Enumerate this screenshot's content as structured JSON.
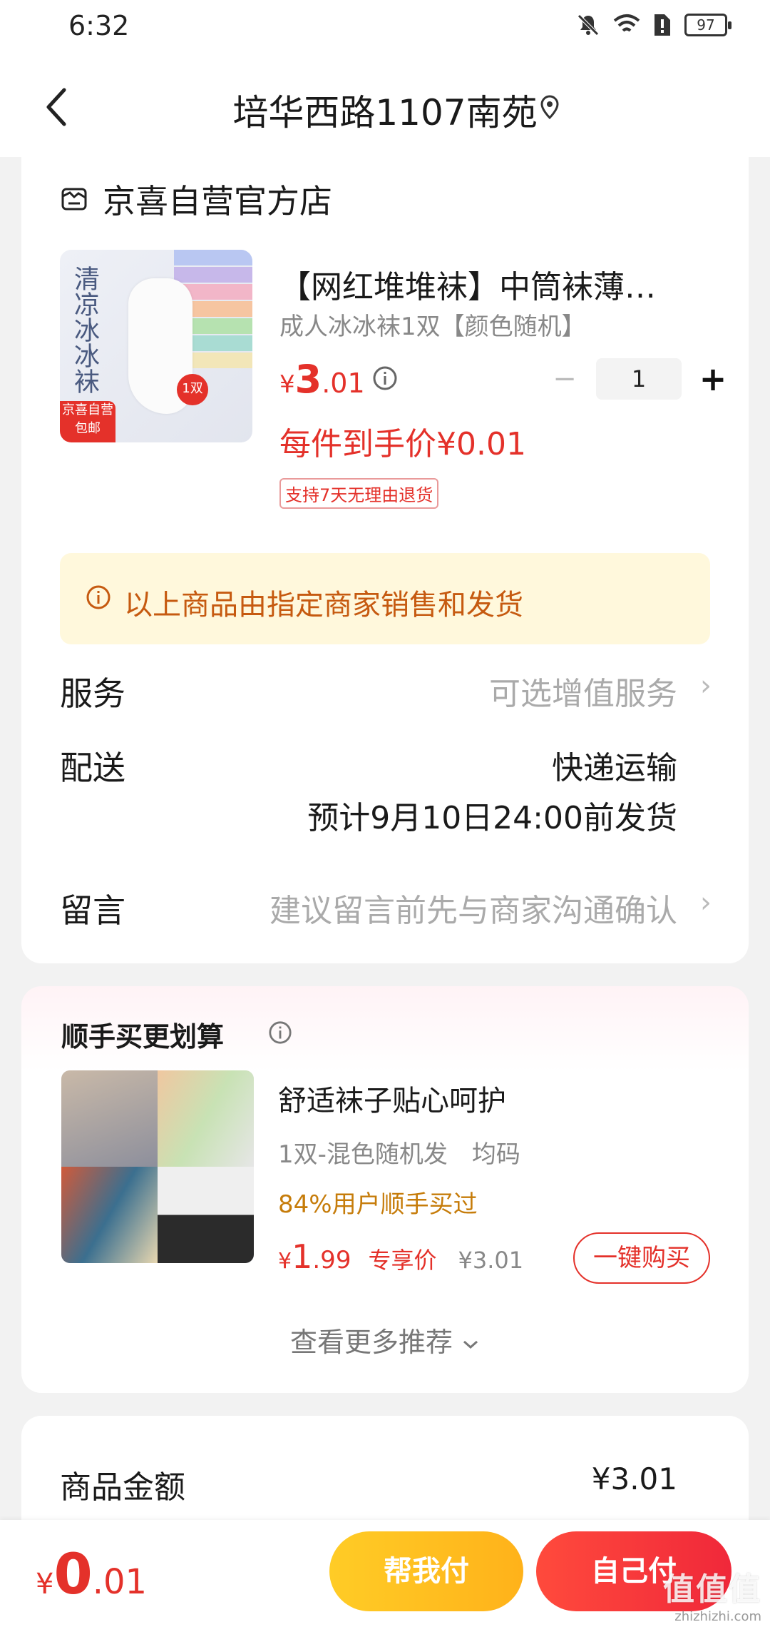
{
  "status_bar": {
    "time": "6:32",
    "battery": "97"
  },
  "header": {
    "title": "培华西路1107南苑"
  },
  "store": {
    "name": "京喜自营官方店"
  },
  "product": {
    "image_text": "清凉冰冰袜",
    "image_badge": "京喜自营 包邮",
    "image_count": "1双",
    "title": "【网红堆堆袜】中筒袜薄…",
    "spec": "成人冰冰袜1双【颜色随机】",
    "price_symbol": "¥",
    "price_int": "3",
    "price_dec": ".01",
    "quantity": "1",
    "unit_price": "每件到手价¥0.01",
    "return_tag": "支持7天无理由退货"
  },
  "notice": {
    "text": "以上商品由指定商家销售和发货"
  },
  "rows": {
    "service_label": "服务",
    "service_value": "可选增值服务",
    "delivery_label": "配送",
    "delivery_method": "快递运输",
    "delivery_eta": "预计9月10日24:00前发货",
    "message_label": "留言",
    "message_placeholder": "建议留言前先与商家沟通确认"
  },
  "recommend": {
    "section_title": "顺手买更划算",
    "title": "舒适袜子贴心呵护",
    "spec": "1双-混色随机发　均码",
    "social": "84%用户顺手买过",
    "price_symbol": "¥",
    "price_int": "1",
    "price_dec": ".99",
    "exclusive_label": "专享价",
    "original_price": "¥3.01",
    "buy_button": "一键购买",
    "more_link": "查看更多推荐"
  },
  "summary": {
    "amount_label": "商品金额",
    "amount_value": "¥3.01"
  },
  "bottom": {
    "total_symbol": "¥",
    "total_int": "0",
    "total_dec": ".01",
    "help_pay": "帮我付",
    "self_pay": "自己付",
    "watermark": "值值值",
    "watermark_url": "zhizhizhi.com"
  },
  "colors": {
    "accent": "#e4312a",
    "notice_bg": "#fff8dc",
    "notice_text": "#c65a10",
    "help_pay": "#ffbf20"
  }
}
